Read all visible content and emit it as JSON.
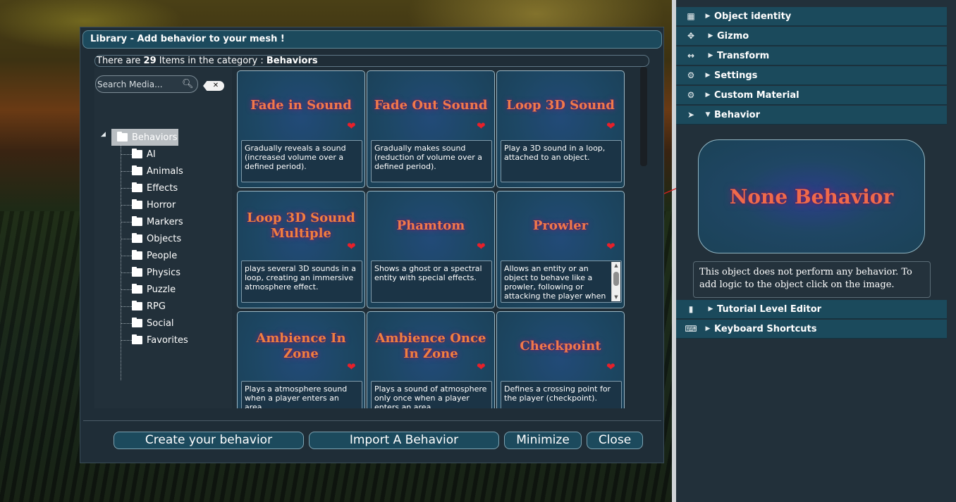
{
  "dialog": {
    "title": "Library - Add behavior to your mesh !",
    "info": {
      "prefix": "There are",
      "count": "29",
      "middle": "Items in the category :",
      "category": "Behaviors"
    },
    "search_placeholder": "Search Media...",
    "clear_label": "✕",
    "tree": {
      "root": "Behaviors",
      "items": [
        "AI",
        "Animals",
        "Effects",
        "Horror",
        "Markers",
        "Objects",
        "People",
        "Physics",
        "Puzzle",
        "RPG",
        "Social",
        "Favorites"
      ]
    },
    "cards": [
      {
        "title": "Fade in Sound",
        "desc": "Gradually reveals a sound (increased volume over a defined period)."
      },
      {
        "title": "Fade Out Sound",
        "desc": "Gradually makes sound (reduction of volume over a defined period)."
      },
      {
        "title": "Loop 3D Sound",
        "desc": "Play a 3D sound in a loop, attached to an object."
      },
      {
        "title": "Loop 3D Sound Multiple",
        "desc": "plays several 3D sounds in a loop, creating an immersive atmosphere effect."
      },
      {
        "title": "Phamtom",
        "desc": "Shows a ghost or a spectral entity with special effects."
      },
      {
        "title": "Prowler",
        "desc": "Allows an entity or an object to behave like a prowler, following or attacking the player when"
      },
      {
        "title": "Ambience In Zone",
        "desc": "Plays a atmosphere sound when a player enters an area."
      },
      {
        "title": "Ambience Once In Zone",
        "desc": "Plays a sound of atmosphere only once when a player enters an area."
      },
      {
        "title": "Checkpoint",
        "desc": "Defines a crossing point for the player (checkpoint)."
      }
    ],
    "buttons": {
      "create": "Create your behavior",
      "import": "Import A Behavior",
      "minimize": "Minimize",
      "close": "Close"
    }
  },
  "panel": {
    "sections": [
      {
        "label": "Object identity",
        "icon": "id-card-icon"
      },
      {
        "label": "Gizmo",
        "icon": "move-icon"
      },
      {
        "label": "Transform",
        "icon": "arrows-horizontal-icon"
      },
      {
        "label": "Settings",
        "icon": "gear-icon"
      },
      {
        "label": "Custom Material",
        "icon": "gear-icon"
      },
      {
        "label": "Behavior",
        "icon": "rocket-icon"
      }
    ],
    "behavior": {
      "card_title": "None Behavior",
      "description": "This object does not perform any behavior. To add logic to the object click on the image."
    },
    "bottom_sections": [
      {
        "label": "Tutorial Level Editor",
        "icon": "book-icon"
      },
      {
        "label": "Keyboard Shortcuts",
        "icon": "keyboard-icon"
      }
    ]
  },
  "colors": {
    "header_bg": "#1b4a5c",
    "panel_bg": "#22303a",
    "title_text": "#f07a4a",
    "heart": "#e8202a"
  }
}
